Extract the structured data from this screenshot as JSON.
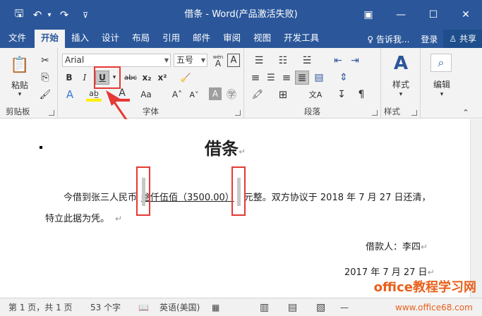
{
  "app": {
    "title": "借条 - Word(产品激活失败)"
  },
  "qat": {
    "save": "🖫",
    "undo": "↶",
    "undo_dd": "▾",
    "redo": "↷",
    "custom": "⊽"
  },
  "winctl": {
    "ribbon_opt": "▣",
    "min": "—",
    "max": "☐",
    "close": "✕"
  },
  "tabs": [
    "文件",
    "开始",
    "插入",
    "设计",
    "布局",
    "引用",
    "邮件",
    "审阅",
    "视图",
    "开发工具"
  ],
  "tabs_right": {
    "tell": "♀ 告诉我...",
    "login": "登录",
    "share": "♙ 共享"
  },
  "ribbon": {
    "clipboard": {
      "label": "剪贴板",
      "paste": "粘贴",
      "paste_dd": "▾",
      "cut": "✂",
      "copy": "⎘",
      "format_painter": "🖌"
    },
    "font": {
      "label": "字体",
      "font_name": "Arial",
      "font_size": "五号",
      "wen": "wén",
      "wen_a": "A",
      "box_a": "A",
      "bold": "B",
      "italic": "I",
      "underline": "U",
      "underline_dd": "▾",
      "strike": "abc",
      "sub": "x₂",
      "sup": "x²",
      "clear": "🧹",
      "text_effect": "A",
      "highlight": "ab̲",
      "font_color": "A",
      "aa": "Aa",
      "grow": "A˄",
      "shrink": "A˅",
      "char_shade": "A",
      "enclose": "㊫"
    },
    "paragraph": {
      "label": "段落",
      "bullets": "☰",
      "numbering": "☷",
      "multilevel": "☱",
      "dec_indent": "⇤",
      "inc_indent": "⇥",
      "align_left": "≡",
      "center": "☰",
      "align_right": "≡",
      "justify": "≣",
      "distributed": "▤",
      "line_spacing": "⇕",
      "shading": "🖍",
      "border": "⊞",
      "chinese_layout": "文A",
      "sort": "↧",
      "show_marks": "¶"
    },
    "styles": {
      "label": "样式",
      "btn": "样式",
      "icon": "A"
    },
    "editing": {
      "label": "编辑",
      "btn": "编辑",
      "icon": "⌕"
    }
  },
  "document": {
    "title": "借条",
    "line1_pre": "今借到张三人民币",
    "line1_underlined": "叁仟伍佰（3500.00）",
    "line1_post": "元整。双方协议于 2018 年 7 月 27 日还清，",
    "line2": "特立此据为凭。",
    "borrower": "借款人：李四",
    "date": "2017 年 7 月 27 日"
  },
  "status": {
    "page": "第 1 页，共 1 页",
    "words": "53 个字",
    "proof_icon": "📖",
    "lang": "英语(美国)",
    "macro_icon": "▦",
    "read_mode": "▥",
    "print_layout": "▤",
    "web_layout": "▧",
    "zoom_minus": "—"
  },
  "watermark": {
    "line1": "office教程学习网",
    "line2": "www.office68.com"
  }
}
